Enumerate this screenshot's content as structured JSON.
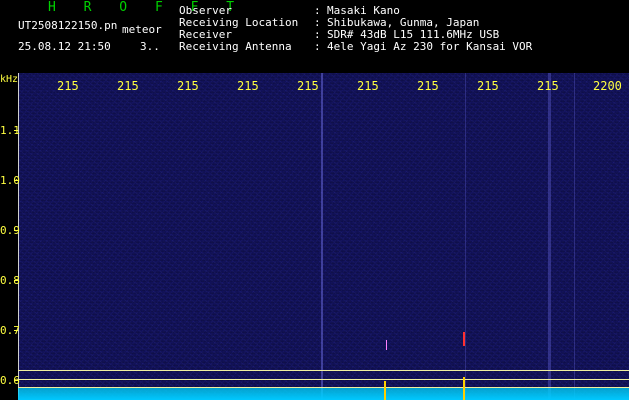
{
  "header": {
    "title": "H R O F F T",
    "filename": "UT2508122150.pn",
    "tag": "meteor",
    "datetime": "25.08.12 21:50",
    "count": "3.."
  },
  "info": [
    {
      "label": "Observer",
      "value": "Masaki Kano"
    },
    {
      "label": "Receiving Location",
      "value": "Shibukawa, Gunma, Japan"
    },
    {
      "label": "Receiver",
      "value": "SDR# 43dB L15 111.6MHz USB"
    },
    {
      "label": "Receiving Antenna",
      "value": "4ele Yagi Az 230 for Kansai VOR"
    }
  ],
  "axis": {
    "y_unit": "kHz",
    "y_ticks": [
      "1.1",
      "1.0",
      "0.9",
      "0.8",
      "0.7",
      "0.6"
    ],
    "x_ticks": [
      "215",
      "215",
      "215",
      "215",
      "215",
      "215",
      "215",
      "215",
      "215",
      "2200"
    ]
  },
  "colors": {
    "label": "#ffff40",
    "title": "#00d000",
    "text": "#ffffff",
    "spectrum": "#00c8ff"
  }
}
